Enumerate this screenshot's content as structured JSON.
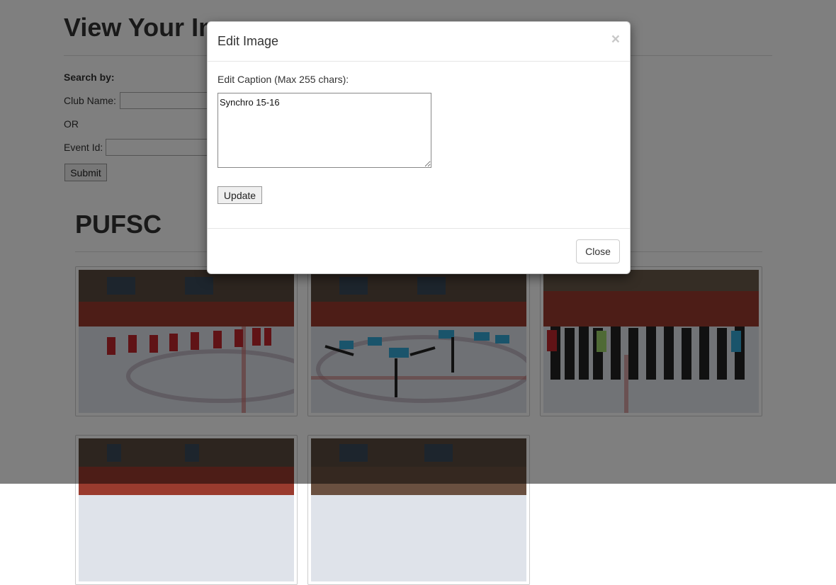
{
  "page": {
    "title": "View Your Images",
    "search_by": "Search by:",
    "club_name_label": "Club Name:",
    "club_name_value": "",
    "or_text": "OR",
    "event_id_label": "Event Id:",
    "event_id_value": "",
    "submit_label": "Submit",
    "club_heading": "PUFSC"
  },
  "modal": {
    "title": "Edit Image",
    "close_x": "×",
    "caption_label": "Edit Caption (Max 255 chars):",
    "caption_value": "Synchro 15-16",
    "update_label": "Update",
    "close_label": "Close"
  }
}
